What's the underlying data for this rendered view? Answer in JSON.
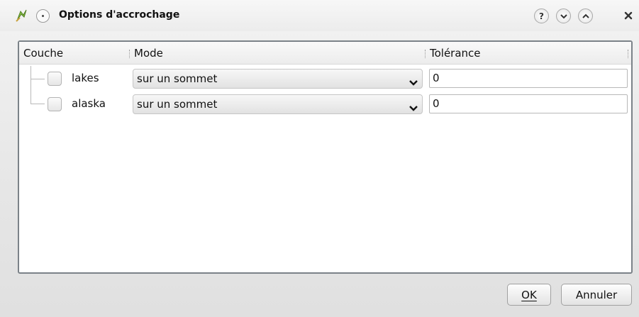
{
  "window": {
    "title": "Options d'accrochage",
    "icons": {
      "app": "qgis-app-icon",
      "menu": "window-menu-icon",
      "help": "help-icon",
      "minimize": "minimize-icon",
      "maximize": "maximize-icon",
      "close": "close-icon"
    }
  },
  "table": {
    "columns": [
      "Couche",
      "Mode",
      "Tolérance"
    ],
    "rows": [
      {
        "layer": "lakes",
        "mode": "sur un sommet",
        "tolerance": "0",
        "checked": false
      },
      {
        "layer": "alaska",
        "mode": "sur un sommet",
        "tolerance": "0",
        "checked": false
      }
    ]
  },
  "buttons": {
    "ok": "OK",
    "cancel": "Annuler"
  },
  "colors": {
    "frame_border": "#7b8288",
    "app_icon": "#7cb342"
  }
}
